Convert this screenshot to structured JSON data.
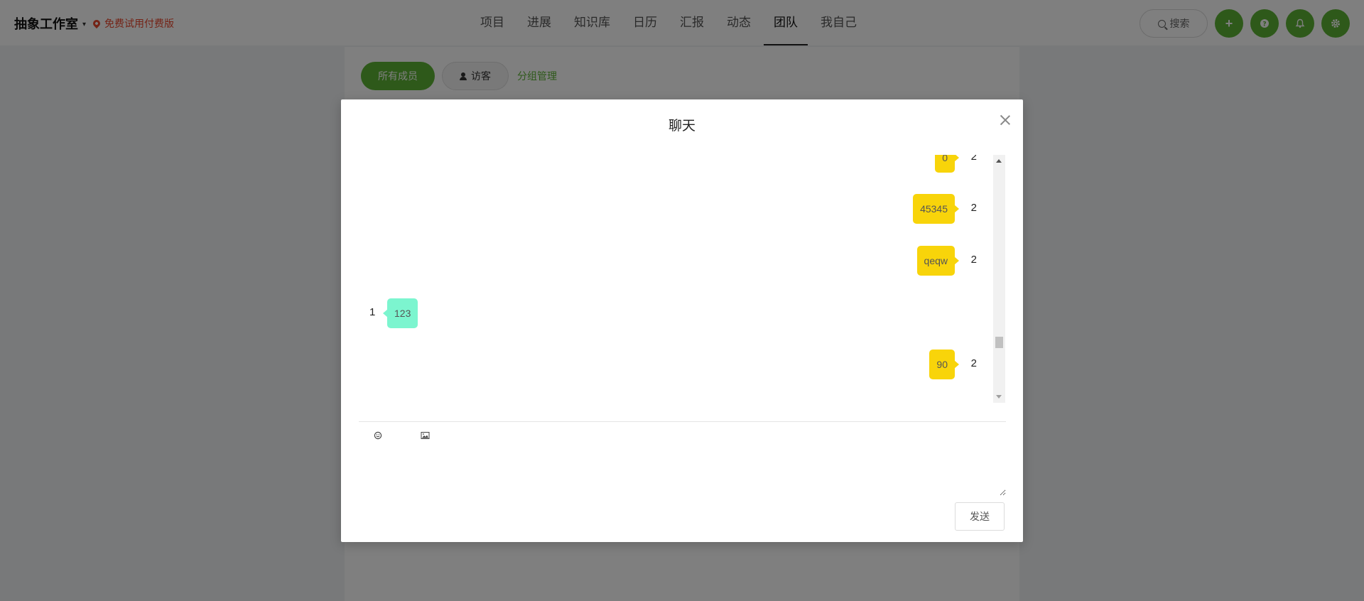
{
  "header": {
    "workspace_name": "抽象工作室",
    "trial_label": "免费试用付费版",
    "nav": [
      "项目",
      "进展",
      "知识库",
      "日历",
      "汇报",
      "动态",
      "团队",
      "我自己"
    ],
    "active_nav": "团队",
    "search_label": "搜索",
    "icons": [
      "plus-icon",
      "help-icon",
      "bell-icon",
      "settings-icon"
    ]
  },
  "team": {
    "tabs": {
      "all_members": "所有成员",
      "visitors": "访客",
      "group_manage": "分组管理"
    }
  },
  "chat": {
    "title": "聊天",
    "messages": [
      {
        "text": "0",
        "sender": "2",
        "side": "right"
      },
      {
        "text": "45345",
        "sender": "2",
        "side": "right"
      },
      {
        "text": "qeqw",
        "sender": "2",
        "side": "right"
      },
      {
        "text": "123",
        "sender": "1",
        "side": "left"
      },
      {
        "text": "90",
        "sender": "2",
        "side": "right"
      }
    ],
    "toolbar_icons": [
      "emoji-icon",
      "image-icon"
    ],
    "send_label": "发送"
  },
  "colors": {
    "brand_green": "#5db234",
    "own_bubble": "#f8d40a",
    "other_bubble": "#7cf5cf",
    "trial_red": "#e8462c"
  }
}
